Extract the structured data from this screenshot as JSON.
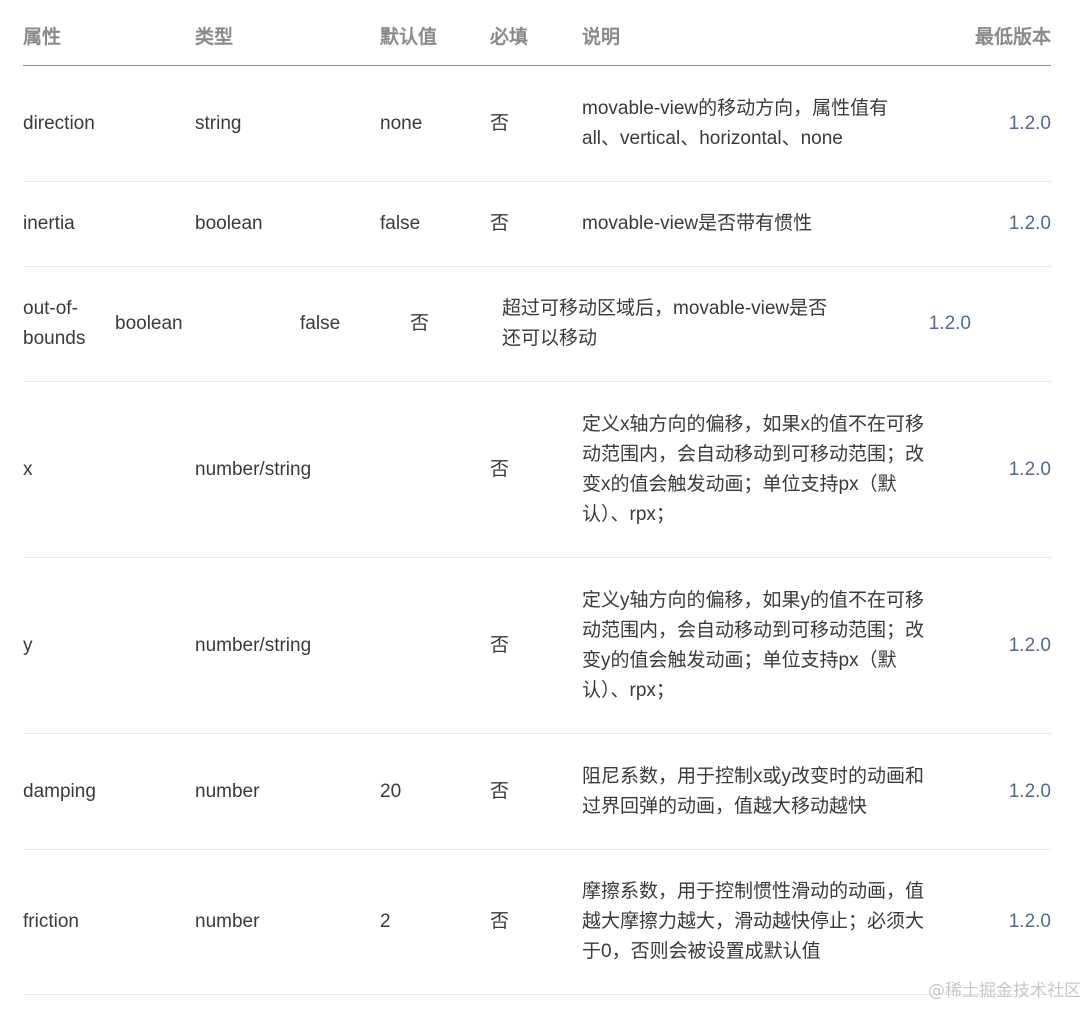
{
  "table": {
    "headers": {
      "name": "属性",
      "type": "类型",
      "default": "默认值",
      "required": "必填",
      "desc": "说明",
      "version": "最低版本"
    },
    "rows": [
      {
        "name": "direction",
        "type": "string",
        "default": "none",
        "required": "否",
        "desc": "movable-view的移动方向，属性值有all、vertical、horizontal、none",
        "version": "1.2.0"
      },
      {
        "name": "inertia",
        "type": "boolean",
        "default": "false",
        "required": "否",
        "desc": "movable-view是否带有惯性",
        "version": "1.2.0"
      },
      {
        "name": "out-of-bounds",
        "type": "boolean",
        "default": "false",
        "required": "否",
        "desc": "超过可移动区域后，movable-view是否还可以移动",
        "version": "1.2.0"
      },
      {
        "name": "x",
        "type": "number/string",
        "default": "",
        "required": "否",
        "desc": "定义x轴方向的偏移，如果x的值不在可移动范围内，会自动移动到可移动范围；改变x的值会触发动画；单位支持px（默认）、rpx；",
        "version": "1.2.0"
      },
      {
        "name": "y",
        "type": "number/string",
        "default": "",
        "required": "否",
        "desc": "定义y轴方向的偏移，如果y的值不在可移动范围内，会自动移动到可移动范围；改变y的值会触发动画；单位支持px（默认）、rpx；",
        "version": "1.2.0"
      },
      {
        "name": "damping",
        "type": "number",
        "default": "20",
        "required": "否",
        "desc": "阻尼系数，用于控制x或y改变时的动画和过界回弹的动画，值越大移动越快",
        "version": "1.2.0"
      },
      {
        "name": "friction",
        "type": "number",
        "default": "2",
        "required": "否",
        "desc": "摩擦系数，用于控制惯性滑动的动画，值越大摩擦力越大，滑动越快停止；必须大于0，否则会被设置成默认值",
        "version": "1.2.0"
      }
    ]
  },
  "watermark": "@稀土掘金技术社区",
  "colors": {
    "header_text": "#8a8a8a",
    "body_text": "#3a3a3a",
    "version_link": "#4e6b97",
    "row_border": "#e8e8e8",
    "header_border": "#8e8e8e"
  }
}
